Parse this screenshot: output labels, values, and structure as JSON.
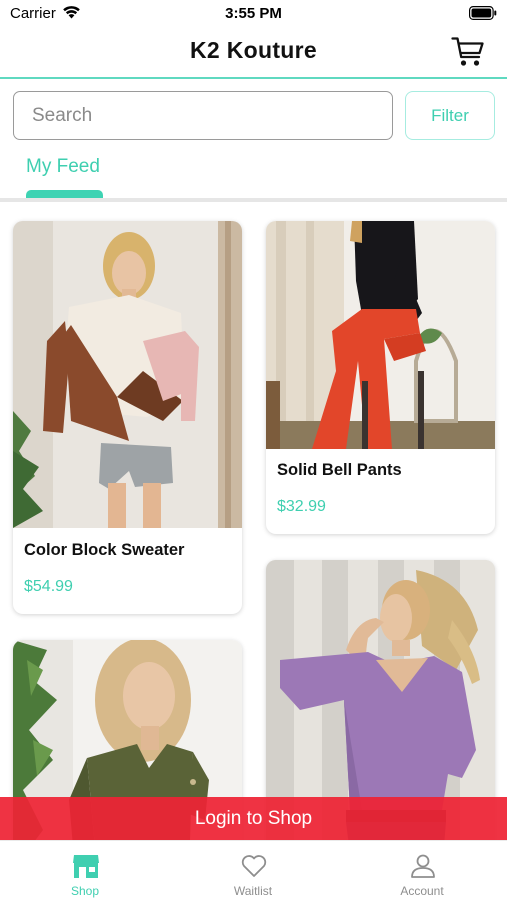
{
  "status_bar": {
    "carrier": "Carrier",
    "time": "3:55 PM"
  },
  "header": {
    "title": "K2 Kouture",
    "cart_icon": "shopping-cart-icon"
  },
  "search": {
    "placeholder": "Search",
    "value": ""
  },
  "filter": {
    "label": "Filter"
  },
  "tabs": [
    {
      "label": "My Feed",
      "active": true
    }
  ],
  "products": [
    {
      "name": "Color Block Sweater",
      "price": "$54.99"
    },
    {
      "name": "Solid Bell Pants",
      "price": "$32.99"
    },
    {
      "name": "",
      "price": ""
    },
    {
      "name": "",
      "price": ""
    }
  ],
  "banner": {
    "label": "Login to Shop"
  },
  "bottom_nav": [
    {
      "label": "Shop",
      "icon": "storefront-icon",
      "active": true
    },
    {
      "label": "Waitlist",
      "icon": "heart-icon",
      "active": false
    },
    {
      "label": "Account",
      "icon": "person-icon",
      "active": false
    }
  ],
  "colors": {
    "accent": "#3fcfb0",
    "banner": "#ee2435",
    "inactive": "#8e8e8e"
  }
}
